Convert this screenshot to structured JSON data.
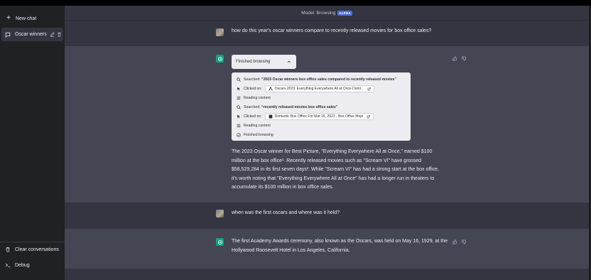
{
  "sidebar": {
    "new_chat_label": "New chat",
    "conversations": [
      {
        "label": "Oscar winners",
        "icon": "chat-bubble-icon"
      }
    ],
    "clear_label": "Clear conversations",
    "debug_label": "Debug"
  },
  "header": {
    "model_label": "Model: Browsing",
    "badge": "ALPHA"
  },
  "messages": [
    {
      "role": "user",
      "text": "how do this year's oscar winners compare to recently released movies for box office sales?"
    },
    {
      "role": "assistant",
      "browse_status": "Finished browsing",
      "steps": [
        {
          "icon": "search-icon",
          "prefix": "Searched: ",
          "text": "“2023 Oscar winners box office sales compared to recently released movies”"
        },
        {
          "icon": "cursor-icon",
          "prefix": "Clicked on:",
          "link": "Oscars 2023: Everything Everywhere All at Once Domi..."
        },
        {
          "icon": "list-icon",
          "text": "Reading content"
        },
        {
          "icon": "search-icon",
          "prefix": "Searched: ",
          "text": "“recently released movies box office sales”"
        },
        {
          "icon": "cursor-icon",
          "prefix": "Clicked on:",
          "link": "Domestic Box Office For Mar 16, 2023 - Box Office Mojo"
        },
        {
          "icon": "list-icon",
          "text": "Reading content"
        },
        {
          "icon": "check-circle-icon",
          "text": "Finished browsing"
        }
      ],
      "lines": [
        "The 2023 Oscar winner for Best Picture, \"Everything Everywhere All at Once,\" earned $100",
        "million at the box office¹. Recently released movies such as \"Scream VI\" have grossed",
        "$58,529,284 in its first seven days². While \"Scream VI\" has had a strong start at the box office,",
        "it's worth noting that \"Everything Everywhere All at Once\" has had a longer run in theaters to",
        "accumulate its $100 million in box office sales."
      ]
    },
    {
      "role": "user",
      "text": "when was the first oscars and where was it held?"
    },
    {
      "role": "assistant",
      "lines": [
        "The first Academy Awards ceremony, also known as the Oscars, was held on May 16, 1929, at the",
        "Hollywood Roosevelt Hotel in Los Angeles, California."
      ]
    }
  ]
}
